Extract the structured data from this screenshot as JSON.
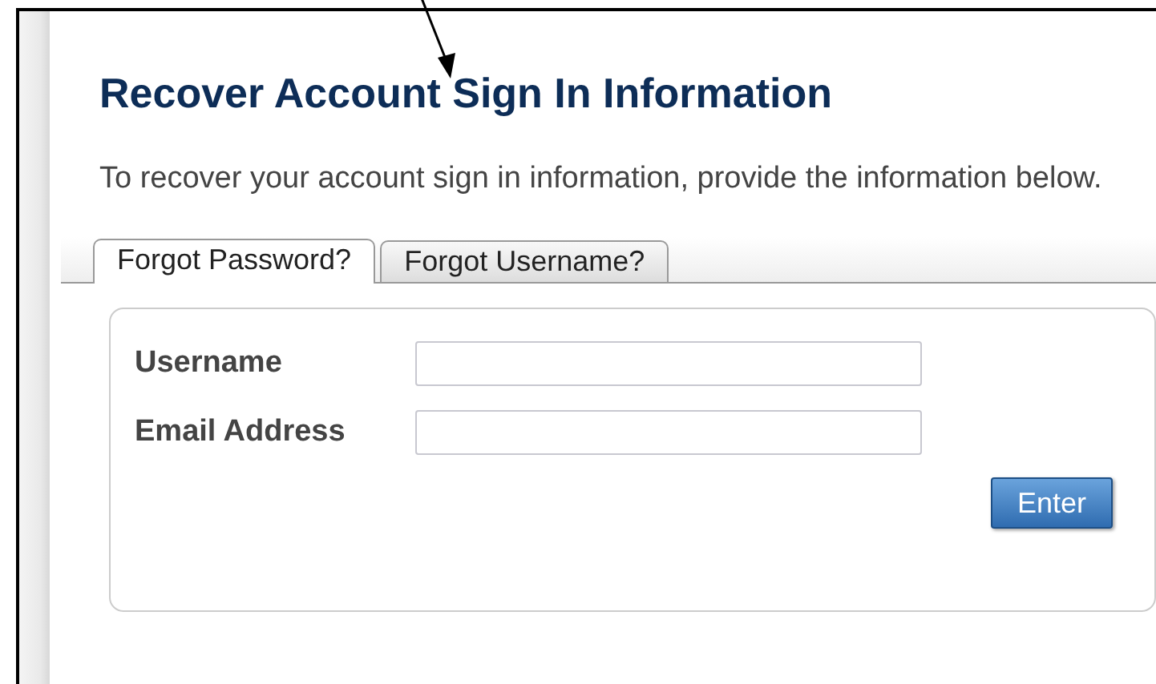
{
  "title": "Recover Account Sign In Information",
  "intro": "To recover your account sign in information, provide the information below.",
  "tabs": [
    {
      "label": "Forgot Password?",
      "selected": true
    },
    {
      "label": "Forgot Username?",
      "selected": false
    }
  ],
  "fields": [
    {
      "label": "Username"
    },
    {
      "label": "Email Address"
    }
  ],
  "submit": {
    "label": "Enter"
  }
}
